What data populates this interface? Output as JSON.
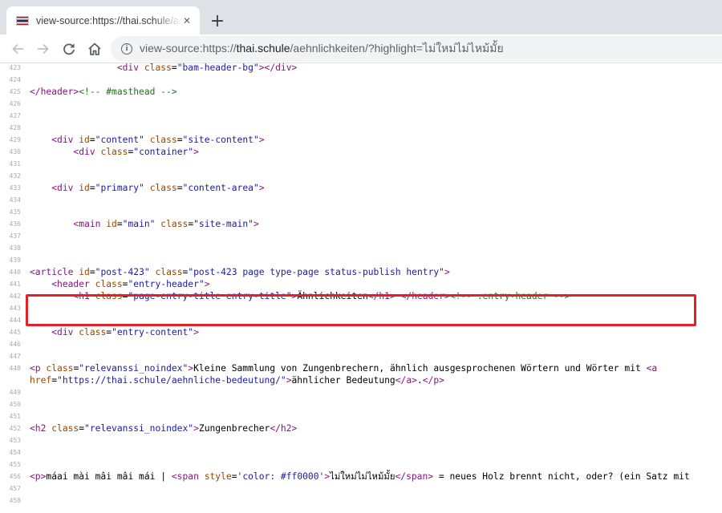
{
  "tab": {
    "title": "view-source:https://thai.schule/aehnlichkeiten/?highlight=ไม่ใหม่ไม่ไหม้มั้ย",
    "close_glyph": "✕"
  },
  "new_tab_glyph": "+",
  "toolbar": {
    "url_prefix": "view-source:https://",
    "url_host": "thai.schule",
    "url_path": "/aehnlichkeiten/?highlight=ไม่ใหม่ไม่ไหม้มั้ย"
  },
  "source_lines": [
    {
      "n": "423",
      "text": "                <div class=\"bam-header-bg\"></div>"
    },
    {
      "n": "424",
      "text": ""
    },
    {
      "n": "425",
      "text": "</header><!-- #masthead -->"
    },
    {
      "n": "426",
      "text": ""
    },
    {
      "n": "427",
      "text": ""
    },
    {
      "n": "428",
      "text": ""
    },
    {
      "n": "429",
      "text": "    <div id=\"content\" class=\"site-content\">"
    },
    {
      "n": "430",
      "text": "        <div class=\"container\">"
    },
    {
      "n": "431",
      "text": ""
    },
    {
      "n": "432",
      "text": ""
    },
    {
      "n": "433",
      "text": "    <div id=\"primary\" class=\"content-area\">"
    },
    {
      "n": "434",
      "text": ""
    },
    {
      "n": "435",
      "text": ""
    },
    {
      "n": "436",
      "text": "        <main id=\"main\" class=\"site-main\">"
    },
    {
      "n": "437",
      "text": ""
    },
    {
      "n": "438",
      "text": ""
    },
    {
      "n": "439",
      "text": ""
    },
    {
      "n": "440",
      "text": "<article id=\"post-423\" class=\"post-423 page type-page status-publish hentry\">"
    },
    {
      "n": "441",
      "text": "    <header class=\"entry-header\">"
    },
    {
      "n": "442",
      "text": "        <h1 class=\"page-entry-title entry-title\">Ähnlichkeiten</h1> </header><!-- .entry-header -->"
    },
    {
      "n": "443",
      "text": ""
    },
    {
      "n": "444",
      "text": ""
    },
    {
      "n": "445",
      "text": "    <div class=\"entry-content\">"
    },
    {
      "n": "446",
      "text": ""
    },
    {
      "n": "447",
      "text": ""
    },
    {
      "n": "448",
      "text": "<p class=\"relevanssi_noindex\">Kleine Sammlung von Zungenbrechern, ähnlich ausgesprochenen Wörtern und Wörter mit <a"
    },
    {
      "n": "",
      "text": "href=\"https://thai.schule/aehnliche-bedeutung/\">ähnlicher Bedeutung</a>.</p>"
    },
    {
      "n": "449",
      "text": ""
    },
    {
      "n": "450",
      "text": ""
    },
    {
      "n": "451",
      "text": ""
    },
    {
      "n": "452",
      "text": "<h2 class=\"relevanssi_noindex\">Zungenbrecher</h2>"
    },
    {
      "n": "453",
      "text": ""
    },
    {
      "n": "454",
      "text": ""
    },
    {
      "n": "455",
      "text": ""
    },
    {
      "n": "456",
      "text": "<p>máai mài mâi mâi mái | <span style='color: #ff0000'>ไม่ใหม่ไม่ไหม้มั้ย</span> = neues Holz brennt nicht, oder? (ein Satz mit"
    },
    {
      "n": "457",
      "text": ""
    },
    {
      "n": "458",
      "text": ""
    }
  ],
  "colors": {
    "tag": "#881280",
    "attr_name": "#994500",
    "attr_value": "#1a1aa6",
    "comment": "#236e25",
    "highlight_border": "#e32028"
  },
  "icons": {
    "favicon": "thailand-flag-icon",
    "back": "arrow-left-icon",
    "forward": "arrow-right-icon",
    "reload": "reload-icon",
    "home": "home-icon",
    "site_info": "info-icon"
  }
}
